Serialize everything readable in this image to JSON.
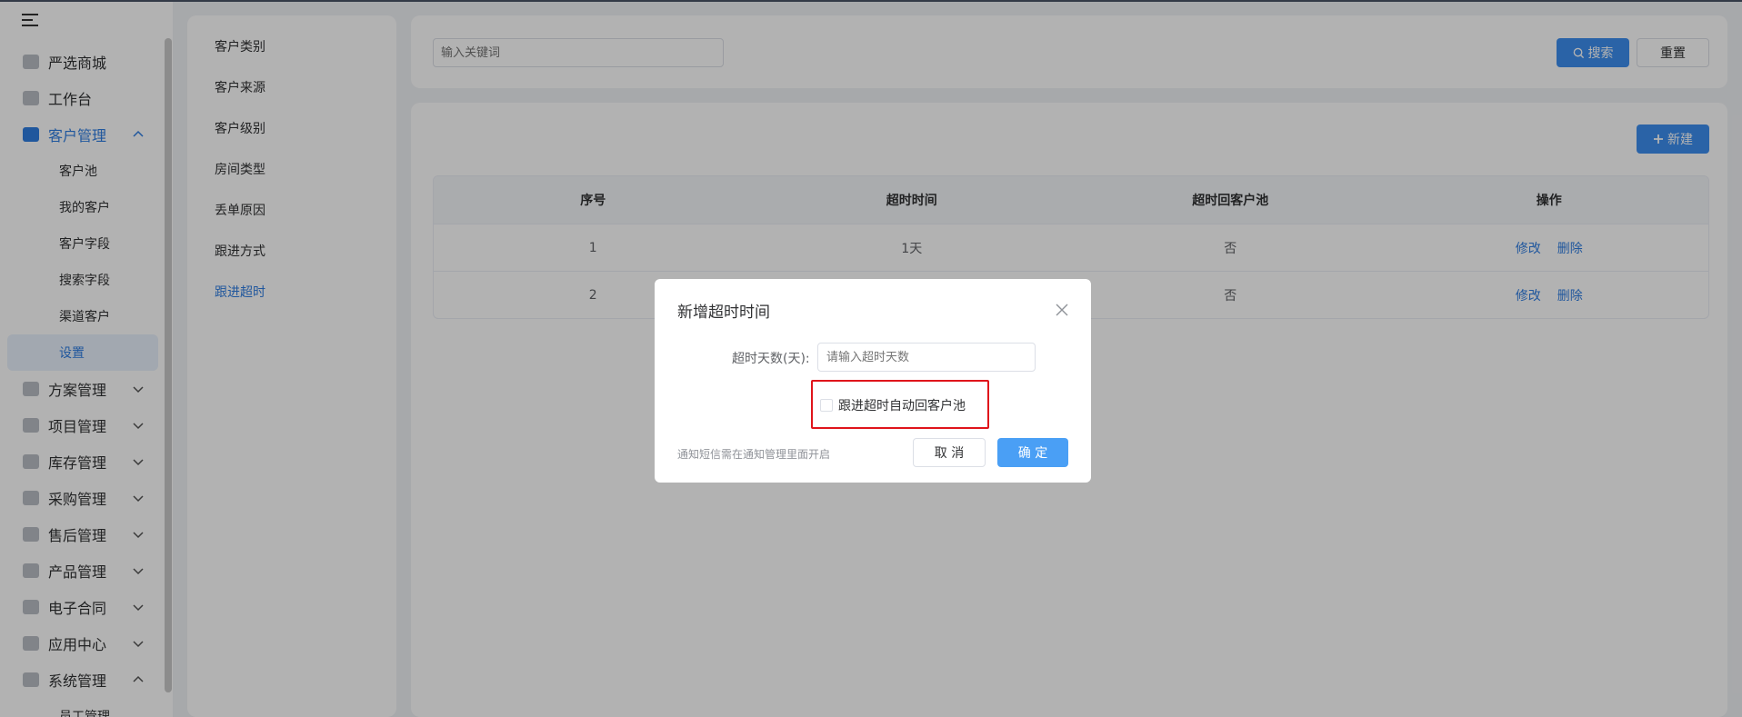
{
  "sidebar": {
    "items": [
      {
        "label": "严选商城",
        "icon": "mall-icon"
      },
      {
        "label": "工作台",
        "icon": "home-icon"
      },
      {
        "label": "客户管理",
        "icon": "customer-icon",
        "expanded": true
      },
      {
        "label": "方案管理",
        "icon": "plan-icon"
      },
      {
        "label": "项目管理",
        "icon": "folder-icon"
      },
      {
        "label": "库存管理",
        "icon": "inventory-icon"
      },
      {
        "label": "采购管理",
        "icon": "cart-icon"
      },
      {
        "label": "售后管理",
        "icon": "headset-icon"
      },
      {
        "label": "产品管理",
        "icon": "box-icon"
      },
      {
        "label": "电子合同",
        "icon": "contract-icon"
      },
      {
        "label": "应用中心",
        "icon": "apps-icon"
      },
      {
        "label": "系统管理",
        "icon": "system-icon",
        "expanded": true
      }
    ],
    "customer_sub": [
      "客户池",
      "我的客户",
      "客户字段",
      "搜索字段",
      "渠道客户",
      "设置"
    ],
    "system_sub": [
      "员工管理"
    ]
  },
  "categories": [
    "客户类别",
    "客户来源",
    "客户级别",
    "房间类型",
    "丢单原因",
    "跟进方式",
    "跟进超时"
  ],
  "search": {
    "placeholder": "输入关键词",
    "search_label": "搜索",
    "reset_label": "重置"
  },
  "toolbar": {
    "new_label": "新建"
  },
  "table": {
    "headers": [
      "序号",
      "超时时间",
      "超时回客户池",
      "操作"
    ],
    "rows": [
      {
        "index": "1",
        "timeout": "1天",
        "back_to_pool": "否",
        "edit": "修改",
        "delete": "删除"
      },
      {
        "index": "2",
        "timeout": "",
        "back_to_pool": "否",
        "edit": "修改",
        "delete": "删除"
      }
    ]
  },
  "dialog": {
    "title": "新增超时时间",
    "days_label": "超时天数(天):",
    "days_placeholder": "请输入超时天数",
    "checkbox_label": "跟进超时自动回客户池",
    "hint": "通知短信需在通知管理里面开启",
    "cancel_label": "取 消",
    "ok_label": "确 定"
  },
  "colors": {
    "accent": "#2f7de1",
    "highlight": "#e0141b"
  }
}
